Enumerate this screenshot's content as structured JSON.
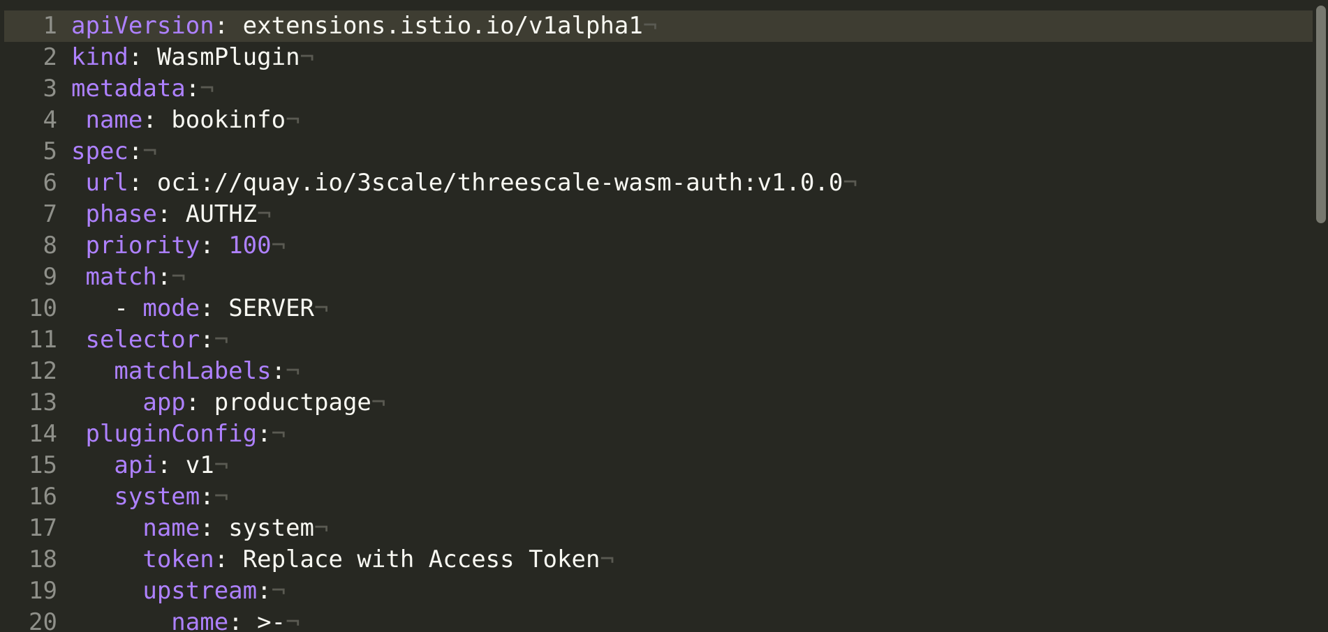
{
  "editor": {
    "eol_marker": "¬",
    "lines": [
      {
        "n": "1",
        "indent": "",
        "key": "apiVersion",
        "sep": ": ",
        "value": "extensions.istio.io/v1alpha1",
        "value_type": "str",
        "current": true
      },
      {
        "n": "2",
        "indent": "",
        "key": "kind",
        "sep": ": ",
        "value": "WasmPlugin",
        "value_type": "str"
      },
      {
        "n": "3",
        "indent": "",
        "key": "metadata",
        "sep": ":",
        "value": "",
        "value_type": "str"
      },
      {
        "n": "4",
        "indent": " ",
        "key": "name",
        "sep": ": ",
        "value": "bookinfo",
        "value_type": "str"
      },
      {
        "n": "5",
        "indent": "",
        "key": "spec",
        "sep": ":",
        "value": "",
        "value_type": "str"
      },
      {
        "n": "6",
        "indent": " ",
        "key": "url",
        "sep": ": ",
        "value": "oci://quay.io/3scale/threescale-wasm-auth:v1.0.0",
        "value_type": "str"
      },
      {
        "n": "7",
        "indent": " ",
        "key": "phase",
        "sep": ": ",
        "value": "AUTHZ",
        "value_type": "str"
      },
      {
        "n": "8",
        "indent": " ",
        "key": "priority",
        "sep": ": ",
        "value": "100",
        "value_type": "num"
      },
      {
        "n": "9",
        "indent": " ",
        "key": "match",
        "sep": ":",
        "value": "",
        "value_type": "str"
      },
      {
        "n": "10",
        "indent": "   - ",
        "key": "mode",
        "sep": ": ",
        "value": "SERVER",
        "value_type": "str"
      },
      {
        "n": "11",
        "indent": " ",
        "key": "selector",
        "sep": ":",
        "value": "",
        "value_type": "str"
      },
      {
        "n": "12",
        "indent": "   ",
        "key": "matchLabels",
        "sep": ":",
        "value": "",
        "value_type": "str"
      },
      {
        "n": "13",
        "indent": "     ",
        "key": "app",
        "sep": ": ",
        "value": "productpage",
        "value_type": "str"
      },
      {
        "n": "14",
        "indent": " ",
        "key": "pluginConfig",
        "sep": ":",
        "value": "",
        "value_type": "str"
      },
      {
        "n": "15",
        "indent": "   ",
        "key": "api",
        "sep": ": ",
        "value": "v1",
        "value_type": "str"
      },
      {
        "n": "16",
        "indent": "   ",
        "key": "system",
        "sep": ":",
        "value": "",
        "value_type": "str"
      },
      {
        "n": "17",
        "indent": "     ",
        "key": "name",
        "sep": ": ",
        "value": "system",
        "value_type": "str"
      },
      {
        "n": "18",
        "indent": "     ",
        "key": "token",
        "sep": ": ",
        "value": "Replace with Access Token",
        "value_type": "str"
      },
      {
        "n": "19",
        "indent": "     ",
        "key": "upstream",
        "sep": ":",
        "value": "",
        "value_type": "str"
      },
      {
        "n": "20",
        "indent": "       ",
        "key": "name",
        "sep": ": ",
        "value": ">-",
        "value_type": "str"
      }
    ]
  },
  "colors": {
    "background": "#272822",
    "current_line": "#3e3d32",
    "key": "#ae81ff",
    "text": "#f8f8f2",
    "line_number": "#8f908a",
    "eol_marker": "#5a5a52"
  }
}
